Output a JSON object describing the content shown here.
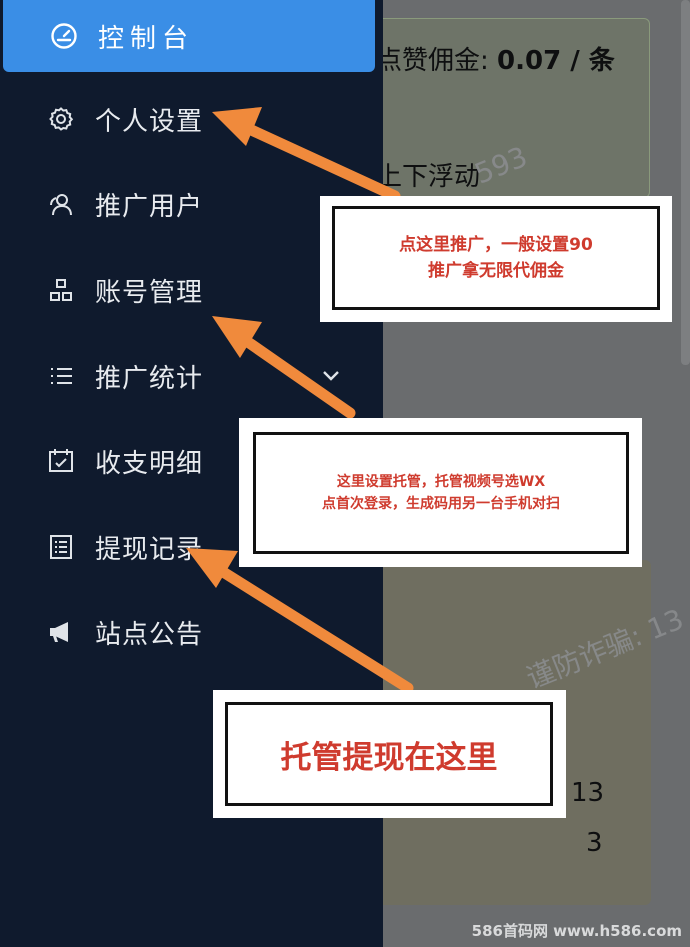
{
  "sidebar": {
    "items": [
      {
        "label": "控制台",
        "icon": "dashboard-gauge-icon",
        "active": true
      },
      {
        "label": "个人设置",
        "icon": "gear-icon"
      },
      {
        "label": "推广用户",
        "icon": "users-icon"
      },
      {
        "label": "账号管理",
        "icon": "org-chart-icon"
      },
      {
        "label": "推广统计",
        "icon": "list-icon",
        "expandable": true
      },
      {
        "label": "收支明细",
        "icon": "calendar-check-icon"
      },
      {
        "label": "提现记录",
        "icon": "document-list-icon"
      },
      {
        "label": "站点公告",
        "icon": "megaphone-icon"
      }
    ]
  },
  "background": {
    "commission_label": "点赞佣金:",
    "commission_value": "0.07 / 条",
    "float_text": "上下浮动",
    "number_1": "13",
    "number_2": "3",
    "watermark_1": "593",
    "watermark_2": "谨防诈骗: 13"
  },
  "annotations": {
    "note_1_line_1": "点这里推广，一般设置90",
    "note_1_line_2": "推广拿无限代佣金",
    "note_2_line_1": "这里设置托管，托管视频号选WX",
    "note_2_line_2": "点首次登录，生成码用另一台手机对扫",
    "note_3": "托管提现在这里"
  },
  "footer": {
    "site": "586首码网 www.h586.com"
  },
  "colors": {
    "sidebar_bg": "#0f1a2d",
    "active_bg": "#3a8ee6",
    "arrow": "#f08a3c",
    "note_text": "#cf3b2e"
  }
}
